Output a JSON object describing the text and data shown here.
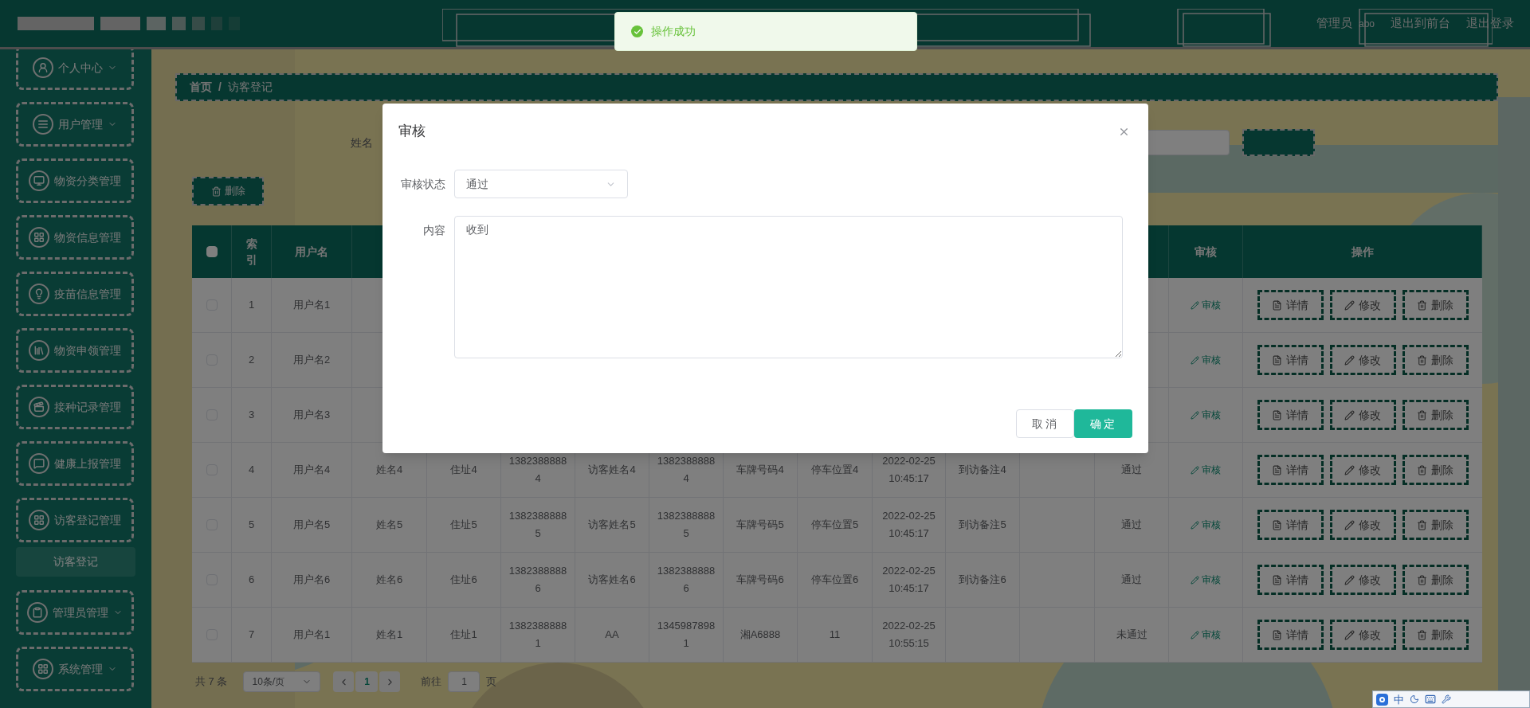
{
  "header": {
    "user_role": "管理员",
    "username": "abo",
    "links": [
      "退出到前台",
      "退出登录"
    ]
  },
  "toast": {
    "message": "操作成功"
  },
  "sidebar": {
    "items": [
      {
        "label": "个人中心",
        "kind": "menu",
        "expandable": true,
        "selected": false
      },
      {
        "label": "用户管理",
        "kind": "menu",
        "expandable": true,
        "selected": false
      },
      {
        "label": "物资分类管理",
        "kind": "menu",
        "expandable": false,
        "selected": false
      },
      {
        "label": "物资信息管理",
        "kind": "menu",
        "expandable": false,
        "selected": false
      },
      {
        "label": "疫苗信息管理",
        "kind": "menu",
        "expandable": false,
        "selected": false
      },
      {
        "label": "物资申领管理",
        "kind": "menu",
        "expandable": false,
        "selected": false
      },
      {
        "label": "接种记录管理",
        "kind": "menu",
        "expandable": false,
        "selected": false
      },
      {
        "label": "健康上报管理",
        "kind": "menu",
        "expandable": false,
        "selected": false
      },
      {
        "label": "访客登记管理",
        "kind": "menu",
        "expandable": false,
        "selected": false
      },
      {
        "label": "访客登记",
        "kind": "submenu",
        "expandable": false,
        "selected": true
      },
      {
        "label": "管理员管理",
        "kind": "menu",
        "expandable": true,
        "selected": false
      },
      {
        "label": "系统管理",
        "kind": "menu",
        "expandable": true,
        "selected": false
      }
    ]
  },
  "breadcrumb": {
    "items": [
      "首页",
      "访客登记"
    ],
    "separator": "/"
  },
  "search": {
    "label": "姓名"
  },
  "toolbar": {
    "delete_button": "删除"
  },
  "table": {
    "header": {
      "select_all_checked": false,
      "index": "索引",
      "username": "用户名",
      "audit": "审核",
      "actions": "操作"
    },
    "rows": [
      {
        "selected": false,
        "index": "1",
        "username": "用户名1",
        "audit": "审核",
        "actions": [
          "详情",
          "修改",
          "删除"
        ]
      },
      {
        "selected": false,
        "index": "2",
        "username": "用户名2",
        "audit": "审核",
        "actions": [
          "详情",
          "修改",
          "删除"
        ]
      },
      {
        "selected": false,
        "index": "3",
        "username": "用户名3",
        "audit": "审核",
        "actions": [
          "详情",
          "修改",
          "删除"
        ]
      },
      {
        "selected": false,
        "index": "4",
        "username": "用户名4",
        "name": "姓名4",
        "address": "住址4",
        "phone": "13823888884",
        "visitor_name": "访客姓名4",
        "visitor_phone": "13823888884",
        "plate": "车牌号码4",
        "parking": "停车位置4",
        "time": "2022-02-25 10:45:17",
        "remark": "到访备注4",
        "status": "通过",
        "audit": "审核",
        "actions": [
          "详情",
          "修改",
          "删除"
        ]
      },
      {
        "selected": false,
        "index": "5",
        "username": "用户名5",
        "name": "姓名5",
        "address": "住址5",
        "phone": "13823888885",
        "visitor_name": "访客姓名5",
        "visitor_phone": "13823888885",
        "plate": "车牌号码5",
        "parking": "停车位置5",
        "time": "2022-02-25 10:45:17",
        "remark": "到访备注5",
        "status": "通过",
        "audit": "审核",
        "actions": [
          "详情",
          "修改",
          "删除"
        ]
      },
      {
        "selected": false,
        "index": "6",
        "username": "用户名6",
        "name": "姓名6",
        "address": "住址6",
        "phone": "13823888886",
        "visitor_name": "访客姓名6",
        "visitor_phone": "13823888886",
        "plate": "车牌号码6",
        "parking": "停车位置6",
        "time": "2022-02-25 10:45:17",
        "remark": "到访备注6",
        "status": "通过",
        "audit": "审核",
        "actions": [
          "详情",
          "修改",
          "删除"
        ]
      },
      {
        "selected": false,
        "index": "7",
        "username": "用户名1",
        "name": "姓名1",
        "address": "住址1",
        "phone": "13823888881",
        "visitor_name": "AA",
        "visitor_phone": "13459878981",
        "plate": "湘A6888",
        "parking": "11",
        "time": "2022-02-25 10:55:15",
        "status": "未通过",
        "audit": "审核",
        "actions": [
          "详情",
          "修改",
          "删除"
        ]
      }
    ]
  },
  "pagination": {
    "total": "共 7 条",
    "page_size": "10条/页",
    "current_page": "1",
    "goto_label": "前往",
    "goto_value": "1",
    "goto_suffix": "页"
  },
  "dialog": {
    "title": "审核",
    "fields": [
      {
        "kind": "select",
        "label": "审核状态",
        "value": "通过"
      },
      {
        "kind": "textarea",
        "label": "内容",
        "value": "收到"
      }
    ],
    "buttons": [
      {
        "label": "取消",
        "kind": "secondary"
      },
      {
        "label": "确定",
        "kind": "primary"
      }
    ]
  },
  "ime": {
    "mode": "中"
  }
}
